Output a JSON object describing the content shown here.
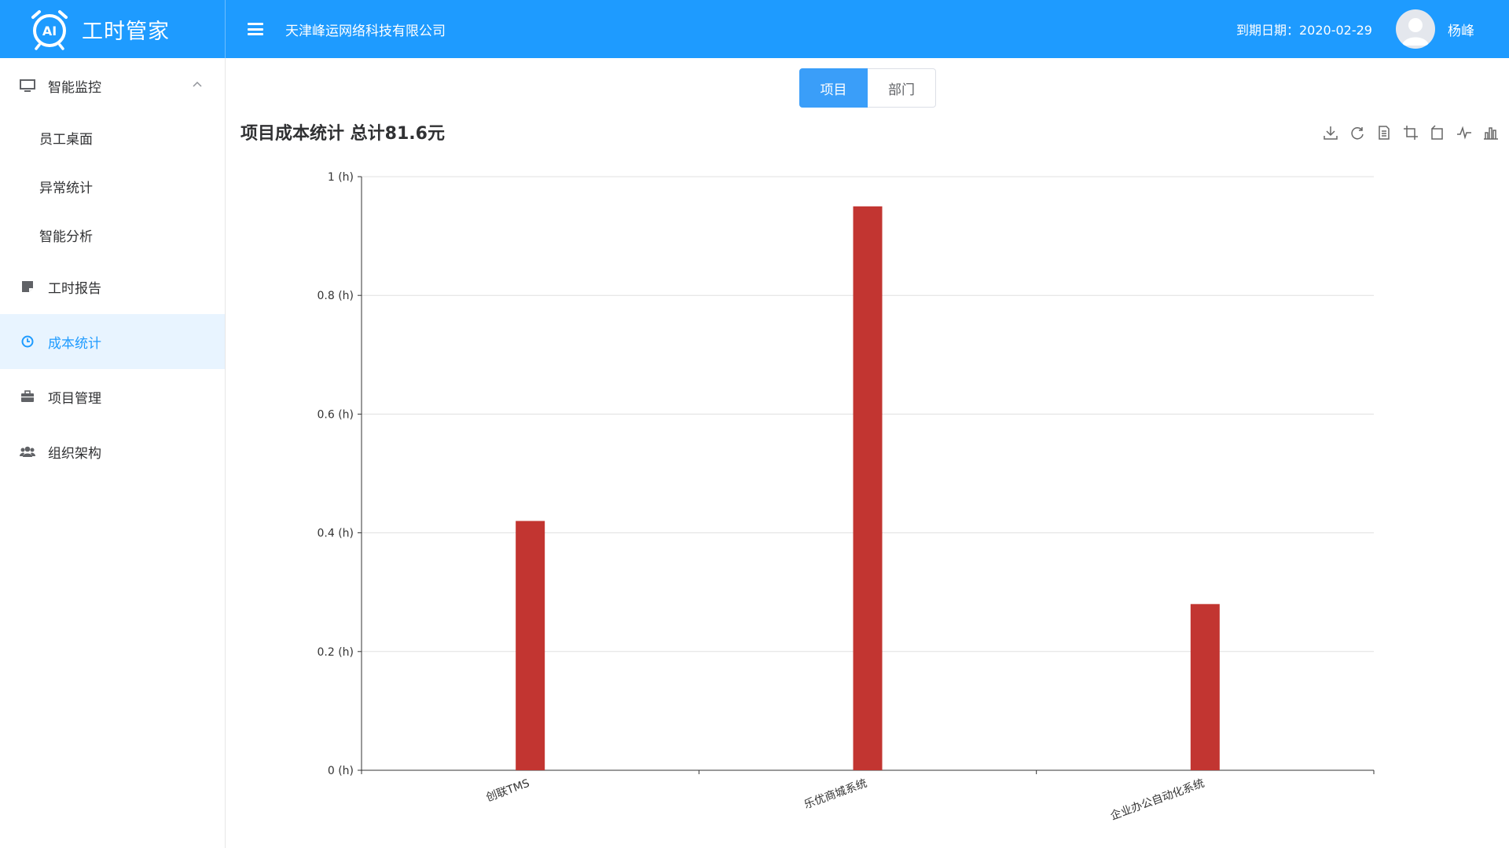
{
  "header": {
    "logo_text": "AI",
    "app_title": "工时管家",
    "company": "天津峰运网络科技有限公司",
    "expire_label": "到期日期：2020-02-29",
    "username": "杨峰"
  },
  "sidebar": {
    "groups": [
      {
        "label": "智能监控",
        "icon": "monitor-icon",
        "expanded": true,
        "children": [
          "员工桌面",
          "异常统计",
          "智能分析"
        ]
      }
    ],
    "items": [
      {
        "label": "工时报告",
        "icon": "report-icon"
      },
      {
        "label": "成本统计",
        "icon": "clock-icon",
        "active": true
      },
      {
        "label": "项目管理",
        "icon": "briefcase-icon"
      },
      {
        "label": "组织架构",
        "icon": "users-icon"
      }
    ]
  },
  "tabs": [
    {
      "label": "项目",
      "active": true
    },
    {
      "label": "部门",
      "active": false
    }
  ],
  "chart_title": "项目成本统计 总计81.6元",
  "toolbox": [
    "download-icon",
    "refresh-icon",
    "data-view-icon",
    "zoom-icon",
    "zoom-reset-icon",
    "line-chart-icon",
    "bar-chart-icon"
  ],
  "colors": {
    "primary": "#1e9bff",
    "bar": "#c23531"
  },
  "chart_data": {
    "type": "bar",
    "categories": [
      "创联TMS",
      "乐优商城系统",
      "企业办公自动化系统"
    ],
    "values": [
      0.42,
      0.95,
      0.28
    ],
    "title": "项目成本统计 总计81.6元",
    "xlabel": "",
    "ylabel": "",
    "ylim": [
      0,
      1
    ],
    "yticks": [
      "0 (h)",
      "0.2 (h)",
      "0.4 (h)",
      "0.6 (h)",
      "0.8 (h)",
      "1 (h)"
    ],
    "grid": true
  }
}
